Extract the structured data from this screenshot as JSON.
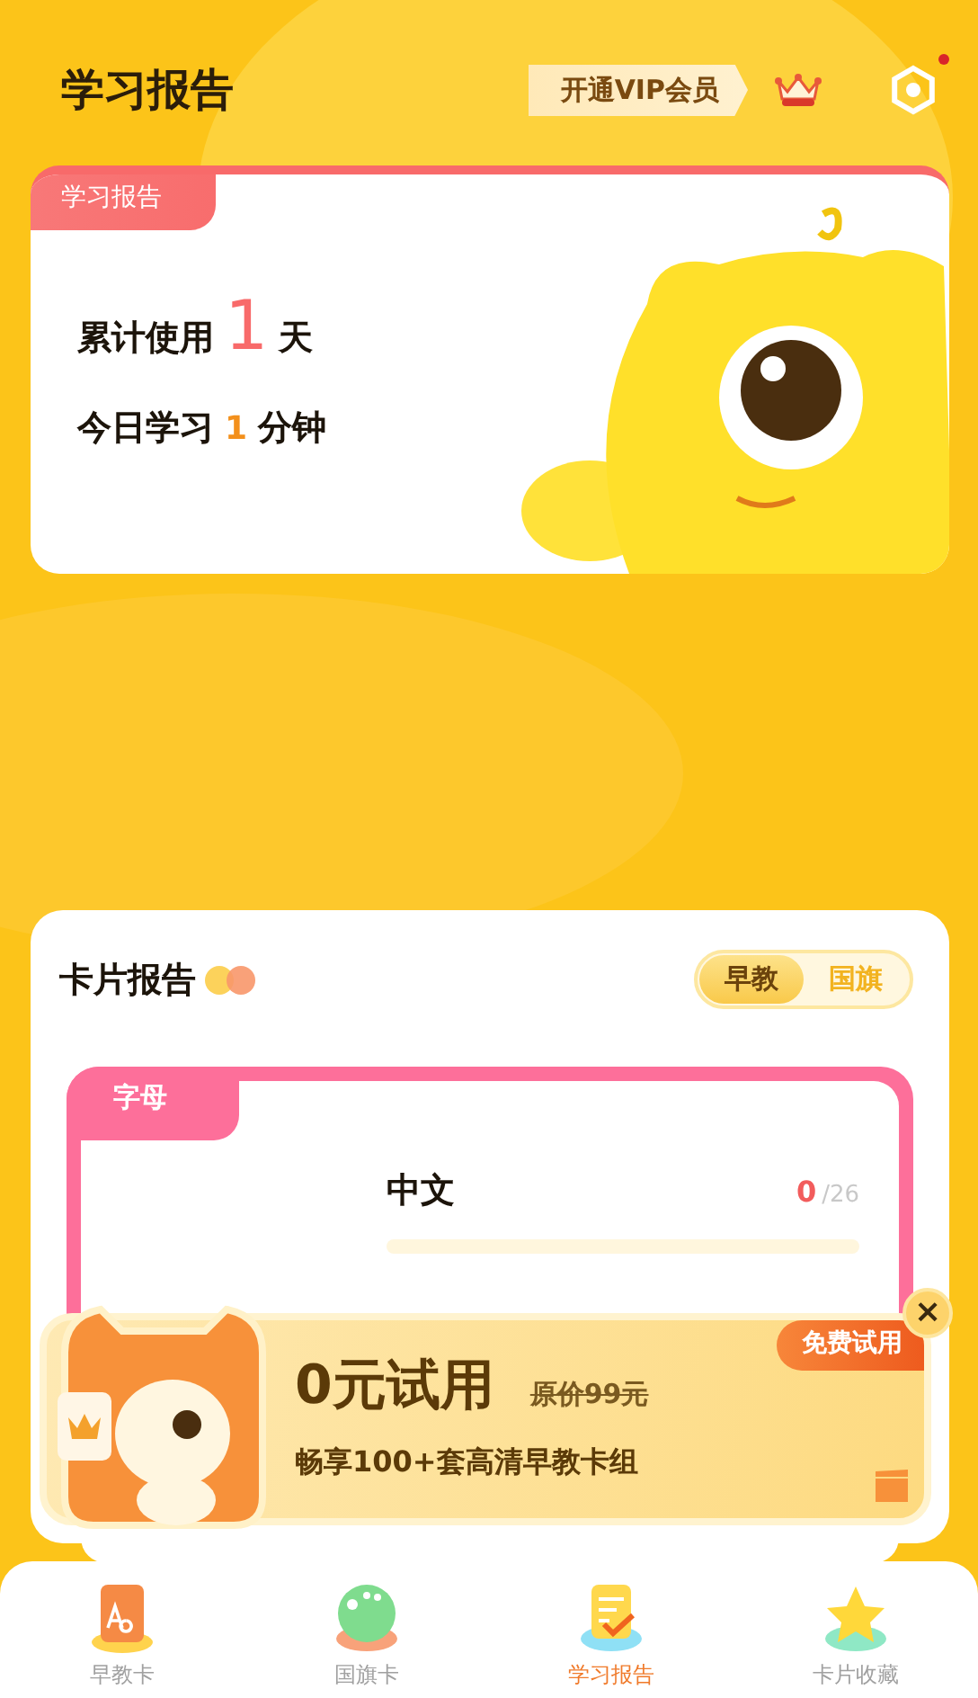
{
  "header": {
    "title": "学习报告",
    "vip_button": "开通VIP会员",
    "settings_badge": true
  },
  "study_report": {
    "tab_label": "学习报告",
    "days_prefix": "累计使用",
    "days_value": "1",
    "days_suffix": "天",
    "minutes_prefix": "今日学习",
    "minutes_value": "1",
    "minutes_suffix": "分钟"
  },
  "card_report": {
    "title": "卡片报告",
    "segments": [
      {
        "label": "早教",
        "selected": true
      },
      {
        "label": "国旗",
        "selected": false
      }
    ],
    "category_tab": "字母",
    "rows": [
      {
        "name": "中文",
        "count": "0",
        "total": "/26",
        "level": 0
      }
    ]
  },
  "ad": {
    "headline": "0元试用",
    "original_price": "原价99元",
    "subtitle": "畅享100+套高清早教卡组",
    "badge": "免费试用",
    "close": "×"
  },
  "bottom_nav": [
    {
      "label": "早教卡",
      "kind": "letters",
      "selected": false
    },
    {
      "label": "国旗卡",
      "kind": "globe",
      "selected": false
    },
    {
      "label": "学习报告",
      "kind": "report",
      "selected": true
    },
    {
      "label": "卡片收藏",
      "kind": "star",
      "selected": false
    }
  ]
}
